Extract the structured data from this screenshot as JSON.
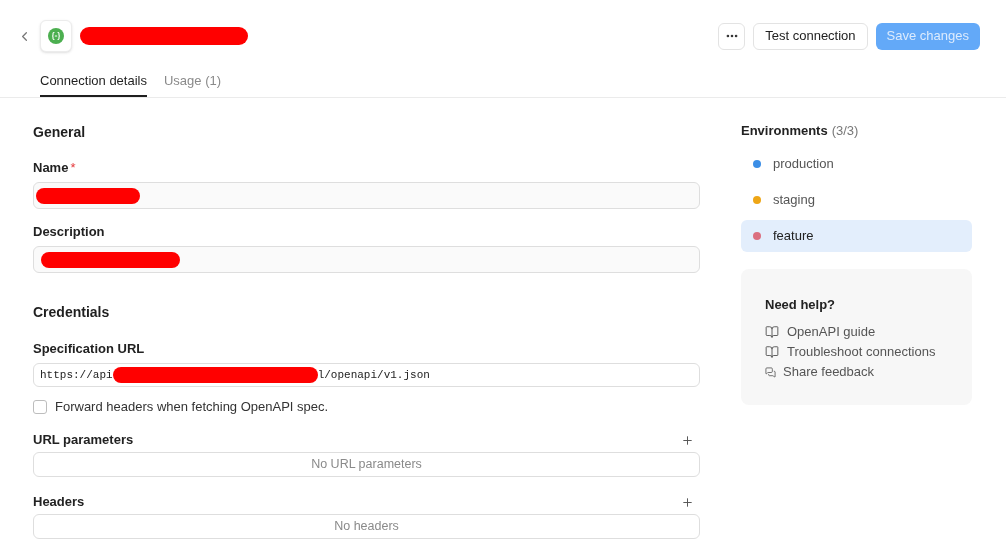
{
  "header": {
    "title_redacted": true,
    "actions": [
      {
        "kind": "more"
      },
      {
        "kind": "secondary",
        "label": "Test connection"
      },
      {
        "kind": "primary",
        "label": "Save changes",
        "disabled": true
      }
    ]
  },
  "tabs": [
    {
      "label": "Connection details",
      "selected": true
    },
    {
      "label": "Usage (1)",
      "selected": false
    }
  ],
  "general": {
    "heading": "General",
    "fields": [
      {
        "label": "Name",
        "required_mark": "*",
        "redacted": true
      },
      {
        "label": "Description",
        "redacted": true
      }
    ]
  },
  "credentials": {
    "heading": "Credentials",
    "spec_url": {
      "label": "Specification URL",
      "value_start": "https://api",
      "redacted": true,
      "value_end": "l/openapi/v1.json"
    },
    "forward_headers": {
      "label": "Forward headers when fetching OpenAPI spec.",
      "checked": false
    },
    "lists": [
      {
        "label": "URL parameters",
        "empty_text": "No URL parameters"
      },
      {
        "label": "Headers",
        "empty_text": "No headers"
      }
    ]
  },
  "environments": {
    "title": "Environments",
    "count": "(3/3)",
    "items": [
      {
        "name": "production",
        "color": "#3b8ee6",
        "selected": false
      },
      {
        "name": "staging",
        "color": "#eea616",
        "selected": false
      },
      {
        "name": "feature",
        "color": "#db6f7f",
        "selected": true
      }
    ]
  },
  "help": {
    "title": "Need help?",
    "links": [
      {
        "kind": "guide",
        "label": "OpenAPI guide"
      },
      {
        "kind": "guide",
        "label": "Troubleshoot connections"
      },
      {
        "kind": "feedback",
        "label": "Share feedback"
      }
    ]
  }
}
